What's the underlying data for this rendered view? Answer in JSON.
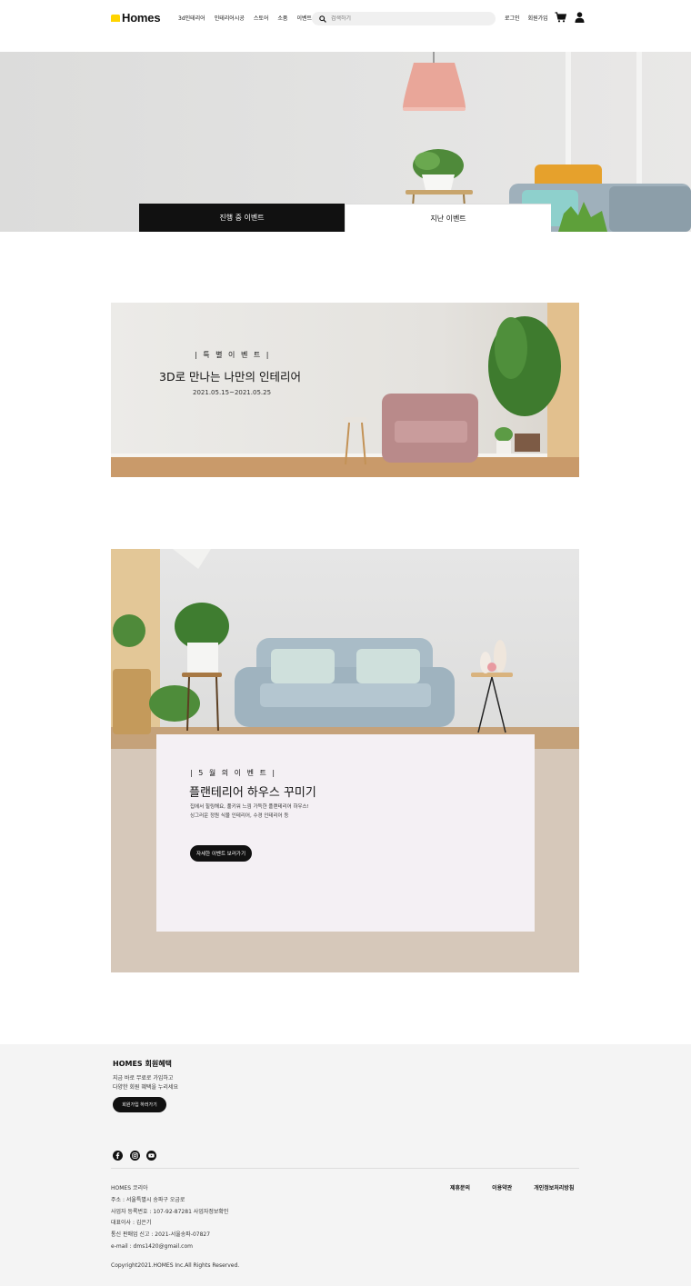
{
  "header": {
    "logo": "Homes",
    "nav": [
      "3d인테리어",
      "인테리어시공",
      "스토어",
      "소품",
      "이벤트"
    ],
    "search_placeholder": "검색하기",
    "login": "로그인",
    "signup": "회원가입"
  },
  "hero": {
    "tab_active": "진행 중 이벤트",
    "tab_past": "지난 이벤트"
  },
  "banner1": {
    "tag": "| 특 별 이 벤 트 |",
    "title": "3D로 만나는 나만의 인테리어",
    "date": "2021.05.15~2021.05.25"
  },
  "banner2": {
    "tag": "| 5 월 의  이 벤 트 |",
    "title": "플랜테리어 하우스 꾸미기",
    "desc_line1": "집에서 힐링해요, 풀키워 느낌 가득한 플랜테리어 하우스!",
    "desc_line2": "싱그러운 정원 식물 인테리어, 수경 인테리어 등",
    "button": "자세한 이벤트 보러가기"
  },
  "footer": {
    "title": "HOMES 회원혜택",
    "desc_line1": "지금 바로 무료로 가입하고",
    "desc_line2": "다양한 회원 혜택을 누리세요",
    "button": "회원가입 하러가기",
    "info": [
      "HOMES 코리아",
      "주소 : 서울특별시 송파구 오금로",
      "사업자 등록번호 : 107-92-87281 사업자정보확인",
      "대표이사 : 김은기",
      "통신 판매업 신고 : 2021-서울송파-07827",
      "e-mail : dms1420@gmail.com"
    ],
    "copyright": "Copyright2021.HOMES Inc.All Rights Reserved.",
    "links": [
      "제휴문의",
      "이용약관",
      "개인정보처리방침"
    ]
  },
  "colors": {
    "accent": "#ffd400",
    "dark": "#111111"
  }
}
